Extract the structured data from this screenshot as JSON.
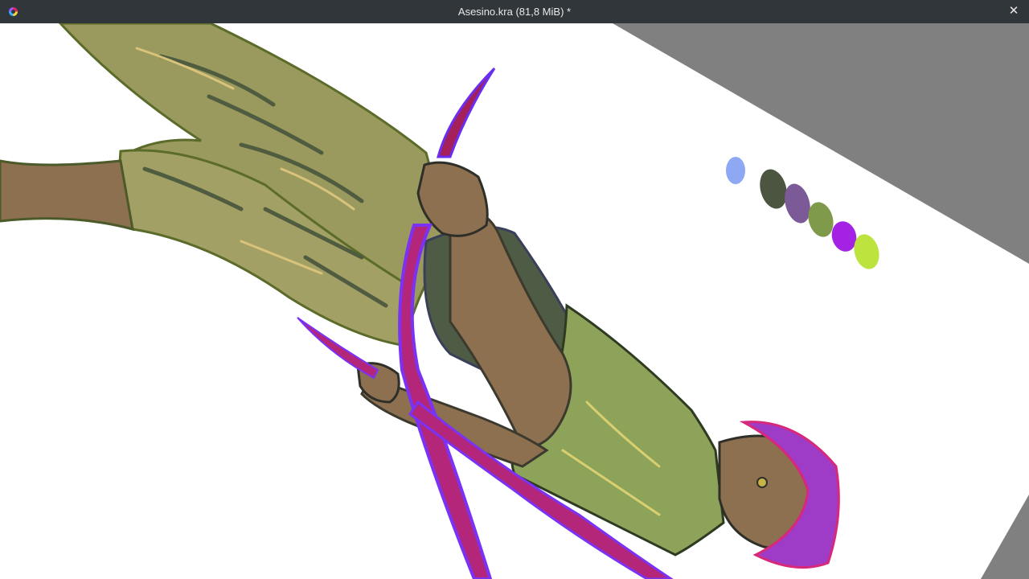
{
  "window": {
    "title": "Asesino.kra (81,8 MiB) *",
    "app_icon": "krita-logo-icon",
    "close_icon": "close-icon",
    "close_glyph": "✕",
    "titlebar_color": "#31363b"
  },
  "canvas": {
    "background_color": "#ffffff",
    "outside_canvas_color": "#808080",
    "palette_swatches": [
      "#8fa8f4",
      "#4c5540",
      "#7c5a97",
      "#7f9a4a",
      "#a322e4",
      "#bde33f"
    ]
  }
}
